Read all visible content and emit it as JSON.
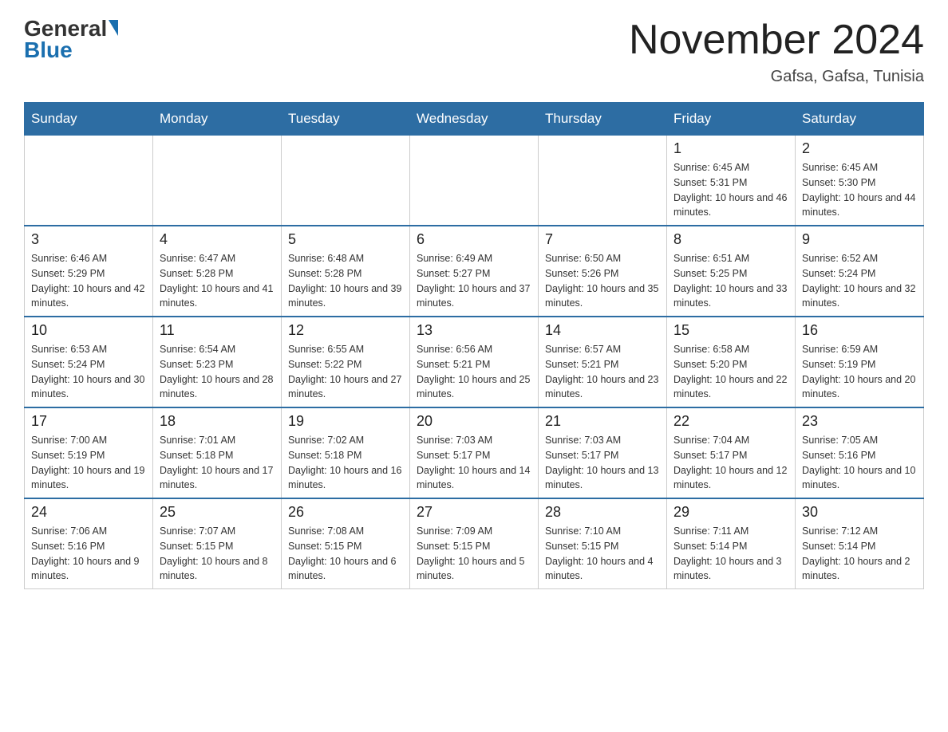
{
  "header": {
    "logo_general": "General",
    "logo_blue": "Blue",
    "month_title": "November 2024",
    "location": "Gafsa, Gafsa, Tunisia"
  },
  "weekdays": [
    "Sunday",
    "Monday",
    "Tuesday",
    "Wednesday",
    "Thursday",
    "Friday",
    "Saturday"
  ],
  "weeks": [
    [
      {
        "day": "",
        "info": ""
      },
      {
        "day": "",
        "info": ""
      },
      {
        "day": "",
        "info": ""
      },
      {
        "day": "",
        "info": ""
      },
      {
        "day": "",
        "info": ""
      },
      {
        "day": "1",
        "info": "Sunrise: 6:45 AM\nSunset: 5:31 PM\nDaylight: 10 hours and 46 minutes."
      },
      {
        "day": "2",
        "info": "Sunrise: 6:45 AM\nSunset: 5:30 PM\nDaylight: 10 hours and 44 minutes."
      }
    ],
    [
      {
        "day": "3",
        "info": "Sunrise: 6:46 AM\nSunset: 5:29 PM\nDaylight: 10 hours and 42 minutes."
      },
      {
        "day": "4",
        "info": "Sunrise: 6:47 AM\nSunset: 5:28 PM\nDaylight: 10 hours and 41 minutes."
      },
      {
        "day": "5",
        "info": "Sunrise: 6:48 AM\nSunset: 5:28 PM\nDaylight: 10 hours and 39 minutes."
      },
      {
        "day": "6",
        "info": "Sunrise: 6:49 AM\nSunset: 5:27 PM\nDaylight: 10 hours and 37 minutes."
      },
      {
        "day": "7",
        "info": "Sunrise: 6:50 AM\nSunset: 5:26 PM\nDaylight: 10 hours and 35 minutes."
      },
      {
        "day": "8",
        "info": "Sunrise: 6:51 AM\nSunset: 5:25 PM\nDaylight: 10 hours and 33 minutes."
      },
      {
        "day": "9",
        "info": "Sunrise: 6:52 AM\nSunset: 5:24 PM\nDaylight: 10 hours and 32 minutes."
      }
    ],
    [
      {
        "day": "10",
        "info": "Sunrise: 6:53 AM\nSunset: 5:24 PM\nDaylight: 10 hours and 30 minutes."
      },
      {
        "day": "11",
        "info": "Sunrise: 6:54 AM\nSunset: 5:23 PM\nDaylight: 10 hours and 28 minutes."
      },
      {
        "day": "12",
        "info": "Sunrise: 6:55 AM\nSunset: 5:22 PM\nDaylight: 10 hours and 27 minutes."
      },
      {
        "day": "13",
        "info": "Sunrise: 6:56 AM\nSunset: 5:21 PM\nDaylight: 10 hours and 25 minutes."
      },
      {
        "day": "14",
        "info": "Sunrise: 6:57 AM\nSunset: 5:21 PM\nDaylight: 10 hours and 23 minutes."
      },
      {
        "day": "15",
        "info": "Sunrise: 6:58 AM\nSunset: 5:20 PM\nDaylight: 10 hours and 22 minutes."
      },
      {
        "day": "16",
        "info": "Sunrise: 6:59 AM\nSunset: 5:19 PM\nDaylight: 10 hours and 20 minutes."
      }
    ],
    [
      {
        "day": "17",
        "info": "Sunrise: 7:00 AM\nSunset: 5:19 PM\nDaylight: 10 hours and 19 minutes."
      },
      {
        "day": "18",
        "info": "Sunrise: 7:01 AM\nSunset: 5:18 PM\nDaylight: 10 hours and 17 minutes."
      },
      {
        "day": "19",
        "info": "Sunrise: 7:02 AM\nSunset: 5:18 PM\nDaylight: 10 hours and 16 minutes."
      },
      {
        "day": "20",
        "info": "Sunrise: 7:03 AM\nSunset: 5:17 PM\nDaylight: 10 hours and 14 minutes."
      },
      {
        "day": "21",
        "info": "Sunrise: 7:03 AM\nSunset: 5:17 PM\nDaylight: 10 hours and 13 minutes."
      },
      {
        "day": "22",
        "info": "Sunrise: 7:04 AM\nSunset: 5:17 PM\nDaylight: 10 hours and 12 minutes."
      },
      {
        "day": "23",
        "info": "Sunrise: 7:05 AM\nSunset: 5:16 PM\nDaylight: 10 hours and 10 minutes."
      }
    ],
    [
      {
        "day": "24",
        "info": "Sunrise: 7:06 AM\nSunset: 5:16 PM\nDaylight: 10 hours and 9 minutes."
      },
      {
        "day": "25",
        "info": "Sunrise: 7:07 AM\nSunset: 5:15 PM\nDaylight: 10 hours and 8 minutes."
      },
      {
        "day": "26",
        "info": "Sunrise: 7:08 AM\nSunset: 5:15 PM\nDaylight: 10 hours and 6 minutes."
      },
      {
        "day": "27",
        "info": "Sunrise: 7:09 AM\nSunset: 5:15 PM\nDaylight: 10 hours and 5 minutes."
      },
      {
        "day": "28",
        "info": "Sunrise: 7:10 AM\nSunset: 5:15 PM\nDaylight: 10 hours and 4 minutes."
      },
      {
        "day": "29",
        "info": "Sunrise: 7:11 AM\nSunset: 5:14 PM\nDaylight: 10 hours and 3 minutes."
      },
      {
        "day": "30",
        "info": "Sunrise: 7:12 AM\nSunset: 5:14 PM\nDaylight: 10 hours and 2 minutes."
      }
    ]
  ]
}
